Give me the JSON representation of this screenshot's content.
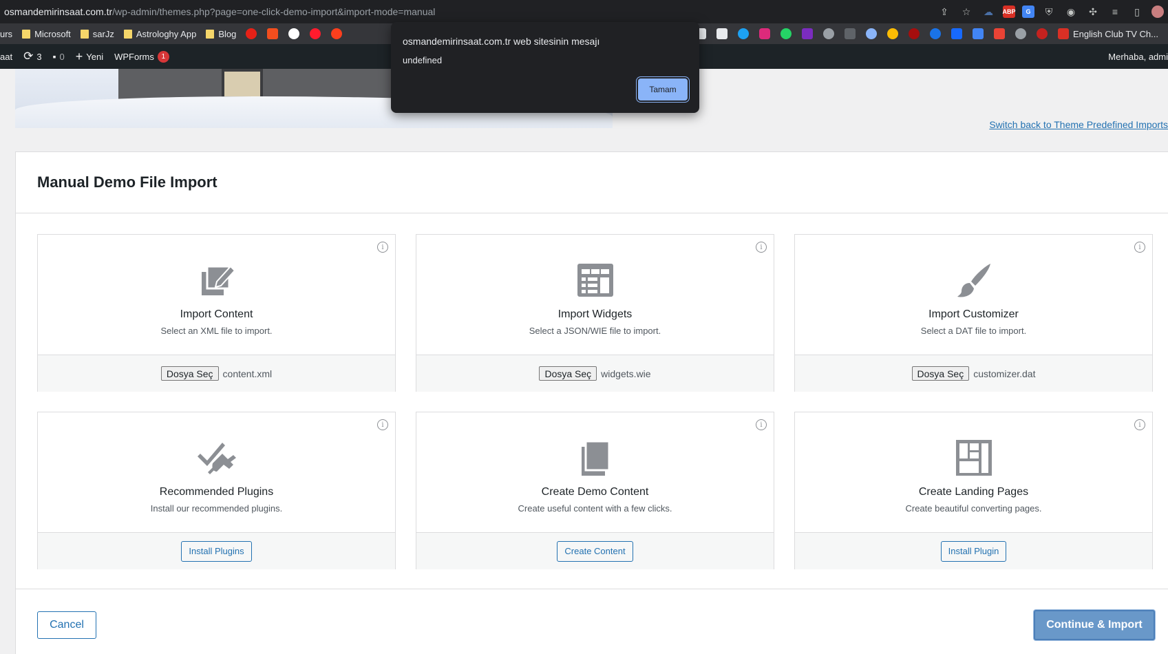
{
  "browser": {
    "url_host": "osmandemirinsaat.com.tr",
    "url_path": "/wp-admin/themes.php?page=one-click-demo-import&import-mode=manual"
  },
  "bookmarks": {
    "left_cut": "urs",
    "items": [
      "Microsoft",
      "sarJz",
      "Astrologhy App",
      "Blog"
    ],
    "right_label": "English Club TV Ch..."
  },
  "adminbar": {
    "site_cut": "aat",
    "updates_count": "3",
    "comments_count": "0",
    "new_label": "Yeni",
    "wpforms_label": "WPForms",
    "wpforms_count": "1",
    "greeting": "Merhaba, admi"
  },
  "switch_link": "Switch back to Theme Predefined Imports",
  "card": {
    "title": "Manual Demo File Import",
    "tiles": [
      {
        "title": "Import Content",
        "desc": "Select an XML file to import.",
        "button": "Dosya Seç",
        "file": "content.xml",
        "icon": "import-content-icon"
      },
      {
        "title": "Import Widgets",
        "desc": "Select a JSON/WIE file to import.",
        "button": "Dosya Seç",
        "file": "widgets.wie",
        "icon": "widgets-icon"
      },
      {
        "title": "Import Customizer",
        "desc": "Select a DAT file to import.",
        "button": "Dosya Seç",
        "file": "customizer.dat",
        "icon": "brush-icon"
      },
      {
        "title": "Recommended Plugins",
        "desc": "Install our recommended plugins.",
        "button": "Install Plugins",
        "icon": "plugin-icon"
      },
      {
        "title": "Create Demo Content",
        "desc": "Create useful content with a few clicks.",
        "button": "Create Content",
        "icon": "pages-icon"
      },
      {
        "title": "Create Landing Pages",
        "desc": "Create beautiful converting pages.",
        "button": "Install Plugin",
        "icon": "layout-icon"
      }
    ],
    "info_glyph": "i",
    "cancel_label": "Cancel",
    "continue_label": "Continue & Import"
  },
  "dialog": {
    "title": "osmandemirinsaat.com.tr web sitesinin mesajı",
    "message": "undefined",
    "ok_label": "Tamam"
  },
  "colors": {
    "primary": "#2271b1",
    "continue_bg": "#6998c9",
    "dialog_button": "#8ab4f8",
    "adminbar": "#1d2327",
    "notification": "#d63638"
  }
}
